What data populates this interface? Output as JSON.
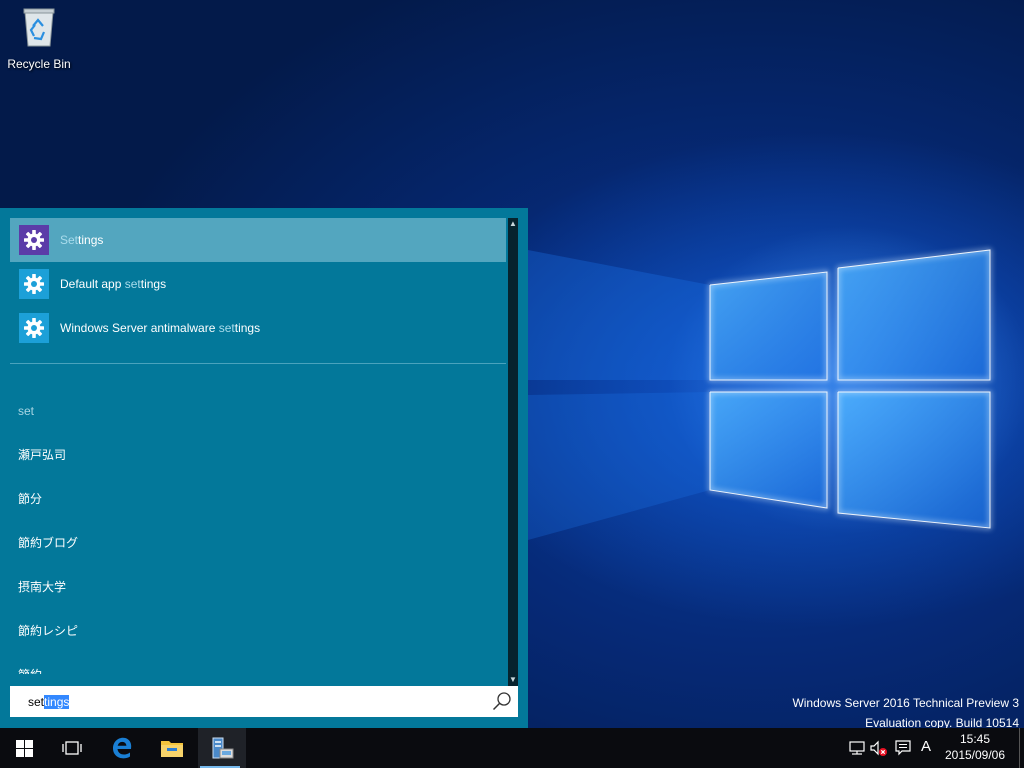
{
  "desktop": {
    "recycle_bin_label": "Recycle Bin",
    "watermark_line1": "Windows Server 2016 Technical Preview 3",
    "watermark_line2": "Evaluation copy. Build 10514"
  },
  "search_results": {
    "items": [
      {
        "match": "Set",
        "rest": "tings",
        "prefix": "",
        "suffix": "",
        "icon": "settings-gear-icon",
        "tile_color": "#5b3ca8",
        "selected": true
      },
      {
        "prefix": "Default app ",
        "match": "set",
        "rest": "tings",
        "suffix": "",
        "icon": "settings-gear-icon",
        "tile_color": "#1ca0d8",
        "selected": false
      },
      {
        "prefix": "Windows Server antimalware ",
        "match": "set",
        "rest": "tings",
        "suffix": "",
        "icon": "settings-gear-icon",
        "tile_color": "#1ca0d8",
        "selected": false
      }
    ]
  },
  "suggestions": {
    "header": "set",
    "items": [
      "瀬戸弘司",
      "節分",
      "節約ブログ",
      "摂南大学",
      "節約レシピ",
      "節約"
    ]
  },
  "search_box": {
    "typed": "set",
    "autocomplete": "tings"
  },
  "taskbar": {
    "ime_indicator": "A",
    "time": "15:45",
    "date": "2015/09/06"
  },
  "colors": {
    "panel": "#03789a",
    "selected_item": "#53a6bf",
    "taskbar": "#0a0b0f",
    "accent": "#76b9ed"
  }
}
